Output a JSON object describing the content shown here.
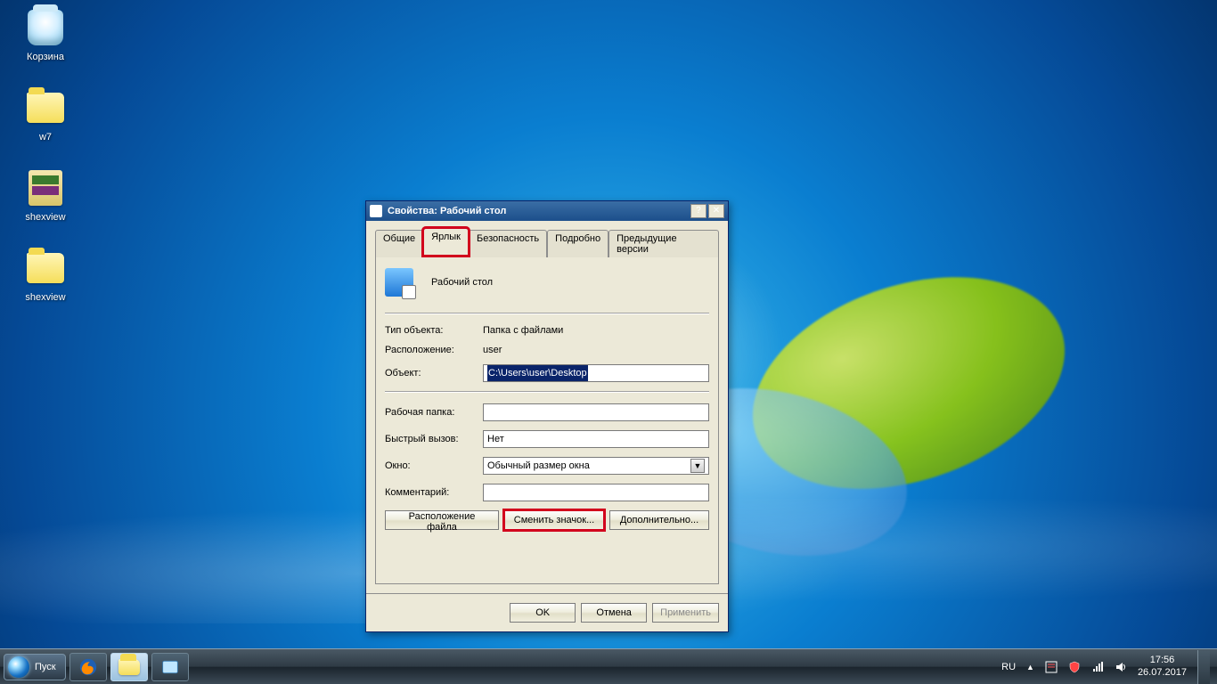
{
  "desktop": {
    "icons": [
      {
        "label": "Корзина",
        "kind": "trash"
      },
      {
        "label": "w7",
        "kind": "folder"
      },
      {
        "label": "shexview",
        "kind": "winrar"
      },
      {
        "label": "shexview",
        "kind": "folder"
      }
    ]
  },
  "dialog": {
    "title": "Свойства: Рабочий стол",
    "tabs": {
      "general": "Общие",
      "shortcut": "Ярлык",
      "security": "Безопасность",
      "details": "Подробно",
      "previous": "Предыдущие версии"
    },
    "name": "Рабочий стол",
    "rows": {
      "type_label": "Тип объекта:",
      "type_value": "Папка с файлами",
      "location_label": "Расположение:",
      "location_value": "user",
      "target_label": "Объект:",
      "target_value": "C:\\Users\\user\\Desktop",
      "workdir_label": "Рабочая папка:",
      "workdir_value": "",
      "hotkey_label": "Быстрый вызов:",
      "hotkey_value": "Нет",
      "run_label": "Окно:",
      "run_value": "Обычный размер окна",
      "comment_label": "Комментарий:",
      "comment_value": ""
    },
    "buttons": {
      "open_loc": "Расположение файла",
      "change_icon": "Сменить значок...",
      "advanced": "Дополнительно..."
    },
    "footer": {
      "ok": "OK",
      "cancel": "Отмена",
      "apply": "Применить"
    }
  },
  "taskbar": {
    "start": "Пуск",
    "lang": "RU",
    "time": "17:56",
    "date": "26.07.2017"
  }
}
